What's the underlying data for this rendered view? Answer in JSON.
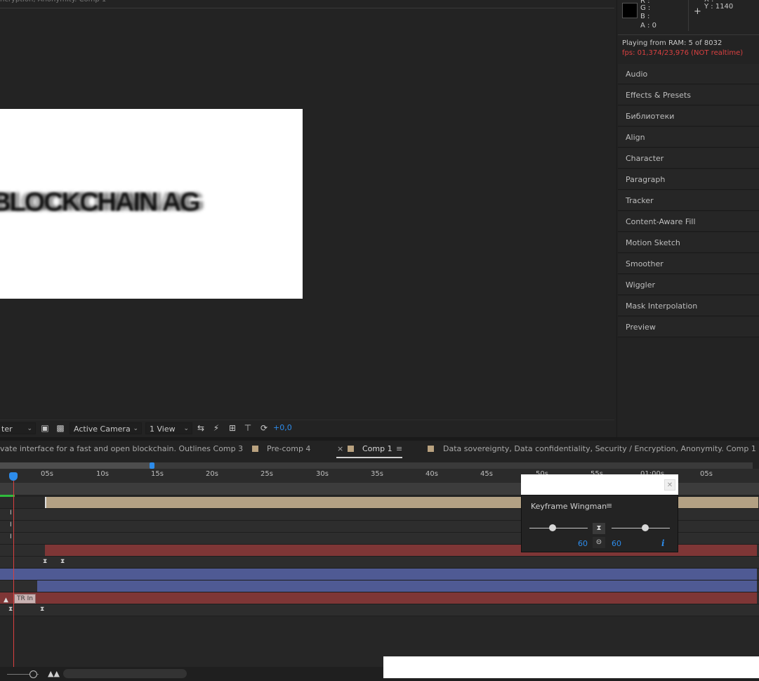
{
  "viewer": {
    "title": "ncryption, Anonymity. Comp 1",
    "canvas_text": "BLOCKCHAIN AG"
  },
  "viewer_toolbar": {
    "resolution": "ter",
    "camera": "Active Camera",
    "views": "1 View",
    "exposure": "+0,0"
  },
  "info": {
    "r": "R :",
    "g": "G :",
    "b": "B :",
    "a": "A :  0",
    "x": "X :",
    "y": "Y :  1140",
    "ram": "Playing from RAM: 5 of 8032",
    "fps": "fps: 01,374/23,976 (NOT realtime)",
    "colors": {
      "fps_warning": "#d94040"
    }
  },
  "right_panels": [
    "Audio",
    "Effects & Presets",
    "Библиотеки",
    "Align",
    "Character",
    "Paragraph",
    "Tracker",
    "Content-Aware Fill",
    "Motion Sketch",
    "Smoother",
    "Wiggler",
    "Mask Interpolation",
    "Preview"
  ],
  "timeline": {
    "tabs": [
      {
        "label": "vate interface for a fast and open blockchain. Outlines Comp 3"
      },
      {
        "label": "Pre-comp 4"
      },
      {
        "label": "Comp 1",
        "active": true,
        "close": "×",
        "menu": "≡"
      },
      {
        "label": "Data sovereignty, Data confidentiality, Security / Encryption, Anonymity. Comp 1"
      }
    ],
    "ruler": [
      "05s",
      "10s",
      "15s",
      "20s",
      "25s",
      "30s",
      "35s",
      "40s",
      "45s",
      "50s",
      "55s",
      "01:00s",
      "05s"
    ],
    "layer_label": "TR In",
    "colors": {
      "accent": "#2d8ceb",
      "tan_bar": "#b9a27f",
      "red_bar": "#7e3636",
      "blue_bar": "#4f5a94"
    }
  },
  "keyframe_wingman": {
    "title": "Keyframe Wingman",
    "menu": "≡",
    "close": "✕",
    "left_value": "60",
    "right_value": "60",
    "info": "i",
    "slider_left_fraction": 0.4,
    "slider_right_fraction": 0.58
  }
}
